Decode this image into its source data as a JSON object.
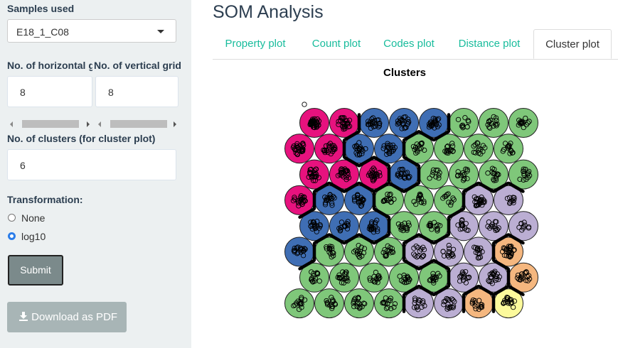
{
  "sidebar": {
    "samples_label": "Samples used",
    "samples_value": "E18_1_C08",
    "hgrid_label": "No. of horizontal g",
    "vgrid_label": "No. of vertical grid",
    "hgrid_value": "8",
    "vgrid_value": "8",
    "clusters_label": "No. of clusters (for cluster plot)",
    "clusters_value": "6",
    "transformation_label": "Transformation:",
    "options": [
      "None",
      "log10"
    ],
    "selected_option": "log10",
    "submit_label": "Submit",
    "download_label": "Download as PDF"
  },
  "main": {
    "title": "SOM Analysis",
    "tabs": [
      "Property plot",
      "Count plot",
      "Codes plot",
      "Distance plot",
      "Cluster plot"
    ],
    "active_tab": "Cluster plot",
    "plot_title": "Clusters"
  },
  "colors": {
    "accent": "#18bc9c",
    "cluster_colors": {
      "magenta": "#e7127e",
      "blue": "#3f6eb4",
      "green": "#7fc77a",
      "lavender": "#bbaed3",
      "orange": "#f5b77f",
      "yellow": "#fcfa9c"
    }
  },
  "som_grid": {
    "rows_top_to_bottom": [
      [
        "magenta",
        "magenta",
        "blue",
        "blue",
        "blue",
        "green",
        "green",
        "green"
      ],
      [
        "magenta",
        "magenta",
        "blue",
        "blue",
        "green",
        "green",
        "green",
        "green"
      ],
      [
        "magenta",
        "magenta",
        "magenta",
        "blue",
        "green",
        "green",
        "green",
        "green"
      ],
      [
        "magenta",
        "blue",
        "blue",
        "green",
        "green",
        "green",
        "lavender",
        "lavender"
      ],
      [
        "blue",
        "blue",
        "blue",
        "green",
        "green",
        "lavender",
        "lavender",
        "lavender"
      ],
      [
        "blue",
        "green",
        "green",
        "green",
        "lavender",
        "lavender",
        "lavender",
        "orange"
      ],
      [
        "green",
        "green",
        "green",
        "green",
        "green",
        "lavender",
        "lavender",
        "orange"
      ],
      [
        "green",
        "green",
        "green",
        "green",
        "lavender",
        "lavender",
        "orange",
        "yellow"
      ]
    ],
    "point_density": [
      [
        9,
        6,
        5,
        5,
        5,
        2,
        3,
        3
      ],
      [
        6,
        5,
        4,
        4,
        3,
        3,
        3,
        3
      ],
      [
        5,
        5,
        5,
        4,
        2,
        3,
        3,
        3
      ],
      [
        5,
        4,
        5,
        3,
        3,
        2,
        5,
        2
      ],
      [
        4,
        3,
        4,
        3,
        3,
        3,
        3,
        2
      ],
      [
        4,
        3,
        3,
        3,
        3,
        3,
        3,
        6
      ],
      [
        3,
        4,
        3,
        3,
        3,
        3,
        5,
        4
      ],
      [
        3,
        3,
        4,
        3,
        3,
        4,
        3,
        4
      ]
    ]
  }
}
